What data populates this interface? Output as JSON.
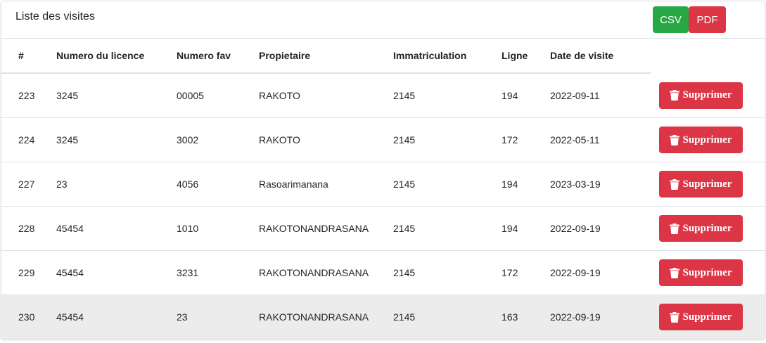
{
  "header": {
    "title": "Liste des visites",
    "csv_label": "CSV",
    "pdf_label": "PDF",
    "csv_color": "#28a745",
    "pdf_color": "#dc3545"
  },
  "table": {
    "columns": [
      "#",
      "Numero du licence",
      "Numero fav",
      "Propietaire",
      "Immatriculation",
      "Ligne",
      "Date de visite"
    ],
    "rows": [
      [
        "223",
        "3245",
        "00005",
        "RAKOTO",
        "2145",
        "194",
        "2022-09-11"
      ],
      [
        "224",
        "3245",
        "3002",
        "RAKOTO",
        "2145",
        "172",
        "2022-05-11"
      ],
      [
        "227",
        "23",
        "4056",
        "Rasoarimanana",
        "2145",
        "194",
        "2023-03-19"
      ],
      [
        "228",
        "45454",
        "1010",
        "RAKOTONANDRASANA",
        "2145",
        "194",
        "2022-09-19"
      ],
      [
        "229",
        "45454",
        "3231",
        "RAKOTONANDRASANA",
        "2145",
        "172",
        "2022-09-19"
      ],
      [
        "230",
        "45454",
        "23",
        "RAKOTONANDRASANA",
        "2145",
        "163",
        "2022-09-19"
      ]
    ],
    "delete_label": "Supprimer",
    "delete_icon": "trash-icon"
  }
}
